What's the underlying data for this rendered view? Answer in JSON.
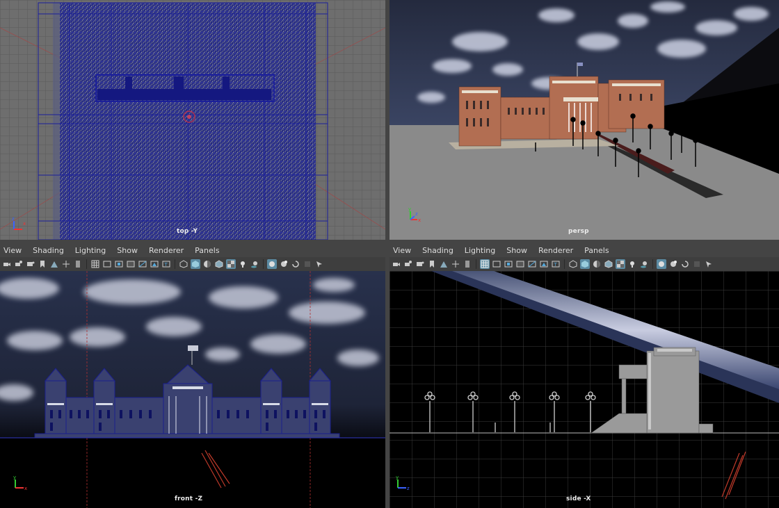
{
  "viewports": {
    "top": {
      "camera": "top -Y"
    },
    "persp": {
      "camera": "persp"
    },
    "front": {
      "camera": "front -Z"
    },
    "side": {
      "camera": "side -X"
    }
  },
  "panel_menu": {
    "items": [
      "View",
      "Shading",
      "Lighting",
      "Show",
      "Renderer",
      "Panels"
    ]
  },
  "axis": {
    "x": "x",
    "y": "y",
    "z": "z"
  },
  "colors": {
    "grid_bg": "#6f6f6f",
    "blueprint": "#1a1f8c",
    "sky": "#2a3450",
    "ground": "#888888",
    "toolbar_active": "#5b8ba3"
  },
  "toolbar_icons": [
    "camera-icon",
    "camera-attr-icon",
    "film-icon",
    "bookmark-icon",
    "image-plane-icon",
    "move-icon",
    "grid-icon",
    "film-gate-icon",
    "resolution-gate-icon",
    "gate-mask-icon",
    "field-chart-icon",
    "safe-action-icon",
    "safe-title-icon",
    "wireframe-icon",
    "smooth-shade-icon",
    "shade-wire-icon",
    "default-material-icon",
    "textured-icon",
    "lights-icon",
    "shadows-icon",
    "ambient-occlusion-icon",
    "motion-blur-icon",
    "anti-alias-icon",
    "depth-of-field-icon",
    "isolate-icon",
    "xray-icon"
  ]
}
